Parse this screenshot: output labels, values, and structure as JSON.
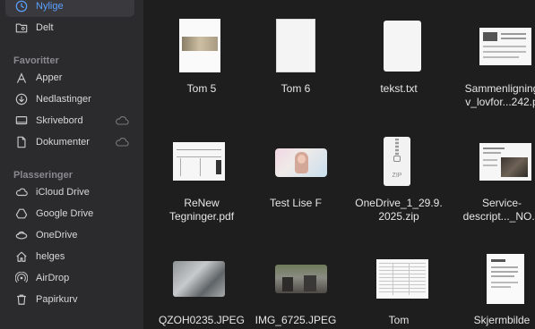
{
  "sidebar": {
    "top": [
      {
        "label": "Nylige",
        "icon": "clock-icon",
        "active": true
      },
      {
        "label": "Delt",
        "icon": "shared-folder-icon"
      }
    ],
    "favorites_header": "Favoritter",
    "favorites": [
      {
        "label": "Apper",
        "icon": "apps-icon"
      },
      {
        "label": "Nedlastinger",
        "icon": "download-icon"
      },
      {
        "label": "Skrivebord",
        "icon": "desktop-icon",
        "cloud": true
      },
      {
        "label": "Dokumenter",
        "icon": "document-icon",
        "cloud": true
      }
    ],
    "locations_header": "Plasseringer",
    "locations": [
      {
        "label": "iCloud Drive",
        "icon": "cloud-icon"
      },
      {
        "label": "Google Drive",
        "icon": "drive-icon"
      },
      {
        "label": "OneDrive",
        "icon": "onedrive-icon"
      },
      {
        "label": "helges",
        "icon": "home-icon"
      },
      {
        "label": "AirDrop",
        "icon": "airdrop-icon"
      },
      {
        "label": "Papirkurv",
        "icon": "trash-icon"
      }
    ]
  },
  "files": {
    "row1": [
      {
        "name1": "Tom 5",
        "name2": ""
      },
      {
        "name1": "Tom 6",
        "name2": ""
      },
      {
        "name1": "tekst.txt",
        "name2": ""
      },
      {
        "name1": "Sammenligning",
        "name2": "v_lovfor...242.p"
      }
    ],
    "row2": [
      {
        "name1": "ReNew",
        "name2": "Tegninger.pdf"
      },
      {
        "name1": "Test Lise F",
        "name2": ""
      },
      {
        "name1": "OneDrive_1_29.9.",
        "name2": "2025.zip"
      },
      {
        "name1": "Service-",
        "name2": "descript..._NO.p"
      }
    ],
    "row3": [
      {
        "name1": "QZOH0235.JPEG",
        "name2": ""
      },
      {
        "name1": "IMG_6725.JPEG",
        "name2": ""
      },
      {
        "name1": "Tom",
        "name2": ""
      },
      {
        "name1": "Skjermbilde",
        "name2": ""
      }
    ],
    "zip_badge": "ZIP"
  }
}
